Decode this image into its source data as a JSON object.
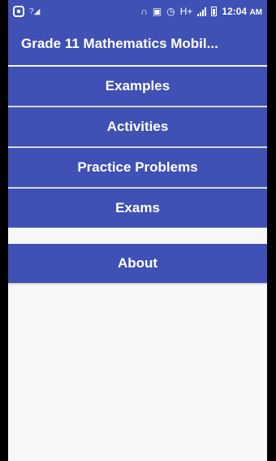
{
  "status_bar": {
    "time": "12:04",
    "time_suffix": "AM",
    "network_label": "H+",
    "sim_label": "?"
  },
  "app_bar": {
    "title": "Grade 11 Mathematics Mobil..."
  },
  "menu": {
    "items": [
      {
        "label": "Examples"
      },
      {
        "label": "Activities"
      },
      {
        "label": "Practice Problems"
      },
      {
        "label": "Exams"
      }
    ],
    "about_label": "About"
  },
  "colors": {
    "primary": "#3f51b5",
    "background": "#f7f7f7"
  },
  "icons": [
    "app-icon",
    "signal-icon",
    "headphones-icon",
    "cast-icon",
    "alarm-icon",
    "cell-signal-icon",
    "battery-icon"
  ]
}
